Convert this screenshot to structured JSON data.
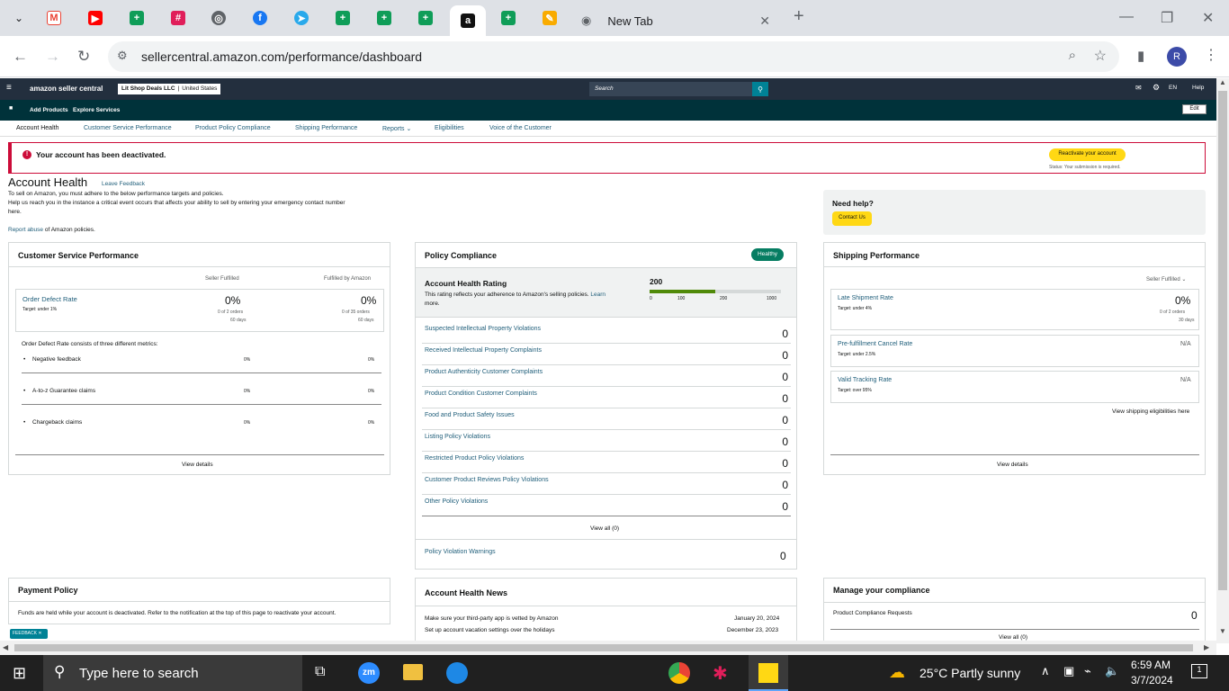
{
  "browser": {
    "tabs": [
      {
        "icon": "chevron-down-icon"
      },
      {
        "icon": "gmail-icon"
      },
      {
        "icon": "youtube-icon"
      },
      {
        "icon": "sheets-icon"
      },
      {
        "icon": "slack-icon"
      },
      {
        "icon": "globe-icon"
      },
      {
        "icon": "facebook-icon"
      },
      {
        "icon": "telegram-icon"
      },
      {
        "icon": "sheets-icon"
      },
      {
        "icon": "sheets-icon"
      },
      {
        "icon": "sheets-icon"
      },
      {
        "icon": "amazon-icon"
      },
      {
        "icon": "sheets-icon"
      },
      {
        "icon": "tasks-icon"
      }
    ],
    "new_tab_title": "New Tab",
    "url": "sellercentral.amazon.com/performance/dashboard",
    "profile_initial": "R",
    "colors": {
      "tabstrip": "#dee1e6",
      "accent": "#1a73e8"
    }
  },
  "amazon": {
    "logo_text": "amazon seller central",
    "store_name": "Lit Shop Deals LLC",
    "store_country": "United States",
    "search_placeholder": "Search",
    "lang": "EN",
    "help": "Help",
    "sub_links": [
      "Add Products",
      "Explore Services"
    ],
    "edit": "Edit",
    "nav_tabs": [
      "Account Health",
      "Customer Service Performance",
      "Product Policy Compliance",
      "Shipping Performance",
      "Reports",
      "Eligibilities",
      "Voice of the Customer"
    ],
    "alert": {
      "message": "Your account has been deactivated.",
      "button": "Reactivate your account",
      "status": "Status: Your submission is required."
    },
    "page_title": "Account Health",
    "leave_feedback": "Leave Feedback",
    "intro1": "To sell on Amazon, you must adhere to the below performance targets and policies.",
    "intro2": "Help us reach you in the instance a critical event occurs that affects your ability to sell by entering your emergency contact number",
    "intro3": "here.",
    "report_abuse_link": "Report abuse",
    "report_abuse_rest": "of Amazon policies.",
    "need_help": "Need help?",
    "contact_us": "Contact Us",
    "csp": {
      "title": "Customer Service Performance",
      "col1": "Seller Fulfilled",
      "col2": "Fulfilled by Amazon",
      "odr_label": "Order Defect Rate",
      "odr_target": "Target: under 1%",
      "odr_sf": "0%",
      "odr_sf_orders": "0 of 2 orders",
      "odr_sf_days": "60 days",
      "odr_fba": "0%",
      "odr_fba_orders": "0 of 35 orders",
      "odr_fba_days": "60 days",
      "consists": "Order Defect Rate consists of three different metrics:",
      "metrics": [
        {
          "name": "Negative feedback",
          "sf": "0%",
          "fba": "0%"
        },
        {
          "name": "A-to-z Guarantee claims",
          "sf": "0%",
          "fba": "0%"
        },
        {
          "name": "Chargeback claims",
          "sf": "0%",
          "fba": "0%"
        }
      ],
      "view_details": "View details"
    },
    "policy": {
      "title": "Policy Compliance",
      "badge": "Healthy",
      "ahr_title": "Account Health Rating",
      "ahr_desc": "This rating reflects your adherence to Amazon's selling policies.",
      "learn": "Learn",
      "more": "more.",
      "ahr_value": "200",
      "ahr_fraction": 0.2,
      "scale": [
        "0",
        "100",
        "200",
        "1000"
      ],
      "rows": [
        {
          "label": "Suspected Intellectual Property Violations",
          "value": "0"
        },
        {
          "label": "Received Intellectual Property Complaints",
          "value": "0"
        },
        {
          "label": "Product Authenticity Customer Complaints",
          "value": "0"
        },
        {
          "label": "Product Condition Customer Complaints",
          "value": "0"
        },
        {
          "label": "Food and Product Safety Issues",
          "value": "0"
        },
        {
          "label": "Listing Policy Violations",
          "value": "0"
        },
        {
          "label": "Restricted Product Policy Violations",
          "value": "0"
        },
        {
          "label": "Customer Product Reviews Policy Violations",
          "value": "0"
        },
        {
          "label": "Other Policy Violations",
          "value": "0"
        }
      ],
      "view_all": "View all (0)",
      "warnings_label": "Policy Violation Warnings",
      "warnings_value": "0"
    },
    "shipping": {
      "title": "Shipping Performance",
      "filter": "Seller Fulfilled",
      "late_label": "Late Shipment Rate",
      "late_target": "Target: under 4%",
      "late_value": "0%",
      "late_orders": "0 of 2 orders",
      "late_days": "30 days",
      "cancel_label": "Pre-fulfillment Cancel Rate",
      "cancel_target": "Target: under 2.5%",
      "cancel_value": "N/A",
      "vtr_label": "Valid Tracking Rate",
      "vtr_target": "Target: over 95%",
      "vtr_value": "N/A",
      "eligibilities_link": "View shipping eligibilities here",
      "view_details": "View details"
    },
    "payment": {
      "title": "Payment Policy",
      "text": "Funds are held while your account is deactivated. Refer to the notification at the top of this page to reactivate your account."
    },
    "news": {
      "title": "Account Health News",
      "items": [
        {
          "title": "Make sure your third-party app is vetted by Amazon",
          "date": "January 20, 2024"
        },
        {
          "title": "Set up account vacation settings over the holidays",
          "date": "December 23, 2023"
        }
      ]
    },
    "compliance": {
      "title": "Manage your compliance",
      "row_label": "Product Compliance Requests",
      "row_value": "0",
      "view_all": "View all (0)"
    },
    "feedback_tab": "FEEDBACK"
  },
  "taskbar": {
    "search_placeholder": "Type here to search",
    "weather": "25°C  Partly sunny",
    "time": "6:59 AM",
    "date": "3/7/2024",
    "notification_count": "1"
  }
}
